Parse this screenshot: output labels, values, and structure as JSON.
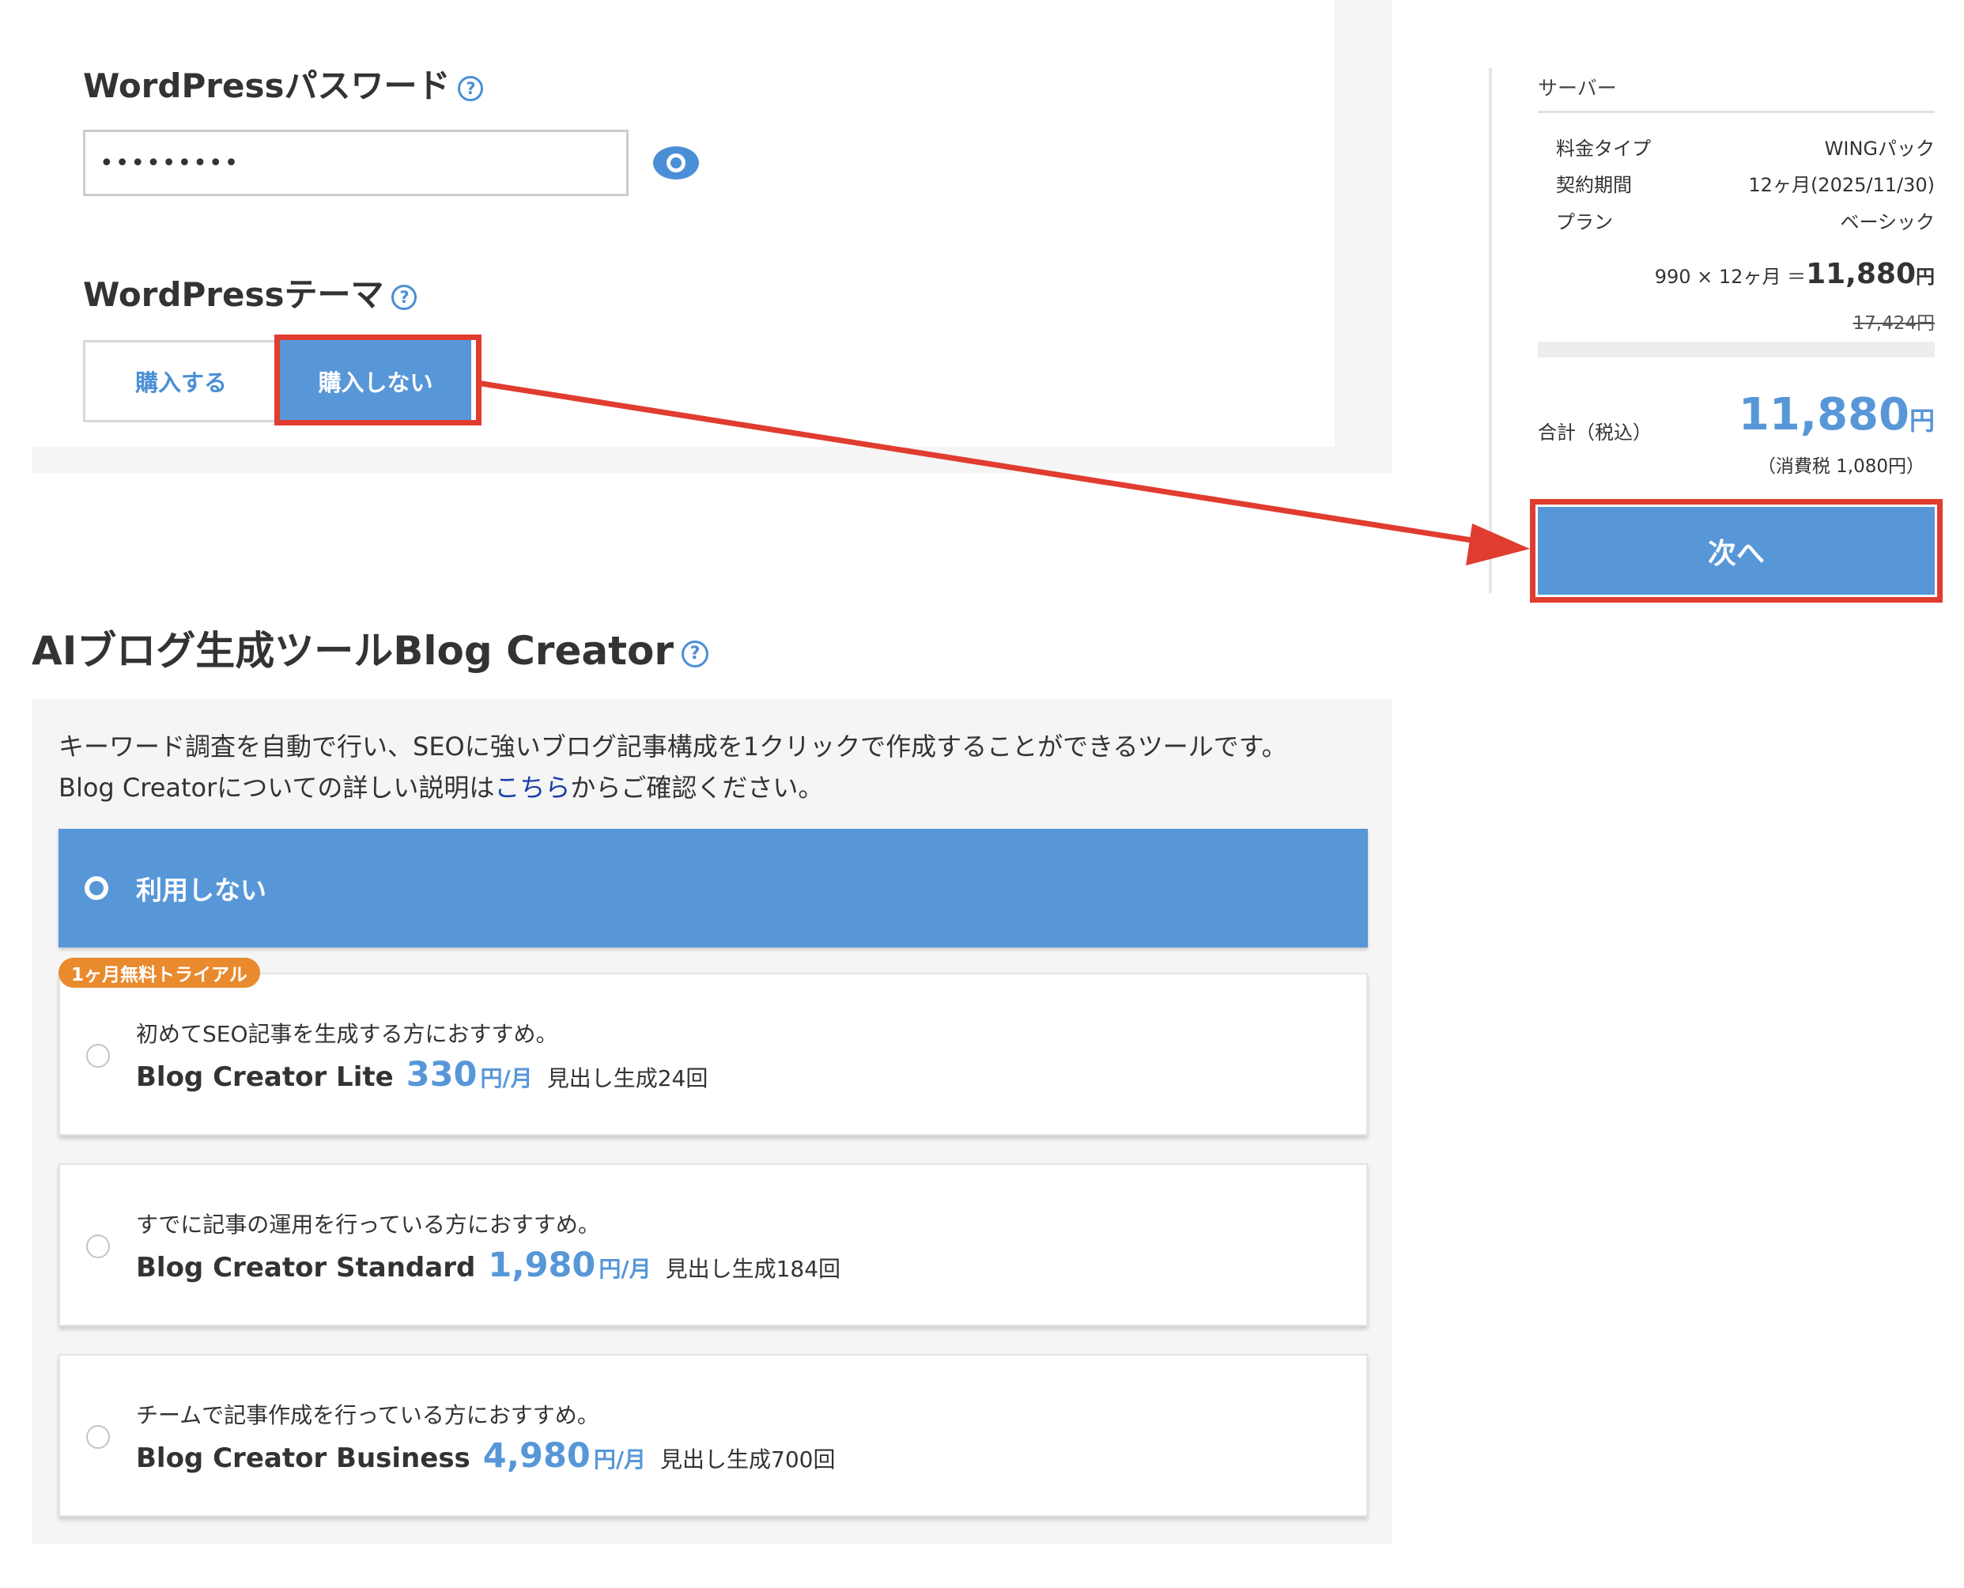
{
  "wordpress": {
    "password_label": "WordPressパスワード",
    "help_mark": "?",
    "password_value": "•••••••••",
    "theme_label": "WordPressテーマ",
    "buy_label": "購入する",
    "no_buy_label": "購入しない"
  },
  "summary": {
    "server_label": "サーバー",
    "rows": [
      {
        "label": "料金タイプ",
        "value": "WINGパック"
      },
      {
        "label": "契約期間",
        "value": "12ヶ月(2025/11/30)"
      },
      {
        "label": "プラン",
        "value": "ベーシック"
      }
    ],
    "calc_prefix": "990 × 12ヶ月 ＝",
    "calc_total": "11,880",
    "yen": "円",
    "original_price": "17,424円",
    "total_label": "合計（税込）",
    "total_value": "11,880",
    "tax_note": "（消費税 1,080円）",
    "next_label": "次へ"
  },
  "blog_creator": {
    "title": "AIブログ生成ツールBlog Creator",
    "desc_line1": "キーワード調査を自動で行い、SEOに強いブログ記事構成を1クリックで作成することができるツールです。",
    "desc_line2_before": "Blog Creatorについての詳しい説明は",
    "desc_link": "こちら",
    "desc_line2_after": "からご確認ください。",
    "none_label": "利用しない",
    "trial_badge": "1ヶ月無料トライアル",
    "plans": [
      {
        "recommend": "初めてSEO記事を生成する方におすすめ。",
        "name": "Blog Creator Lite",
        "price": "330",
        "unit": "円/月",
        "count": "見出し生成24回"
      },
      {
        "recommend": "すでに記事の運用を行っている方におすすめ。",
        "name": "Blog Creator Standard",
        "price": "1,980",
        "unit": "円/月",
        "count": "見出し生成184回"
      },
      {
        "recommend": "チームで記事作成を行っている方におすすめ。",
        "name": "Blog Creator Business",
        "price": "4,980",
        "unit": "円/月",
        "count": "見出し生成700回"
      }
    ]
  },
  "colors": {
    "accent_blue": "#5797d8",
    "highlight_red": "#e03c2f",
    "trial_orange": "#e98a2e",
    "link_blue": "#1a3fa8"
  }
}
